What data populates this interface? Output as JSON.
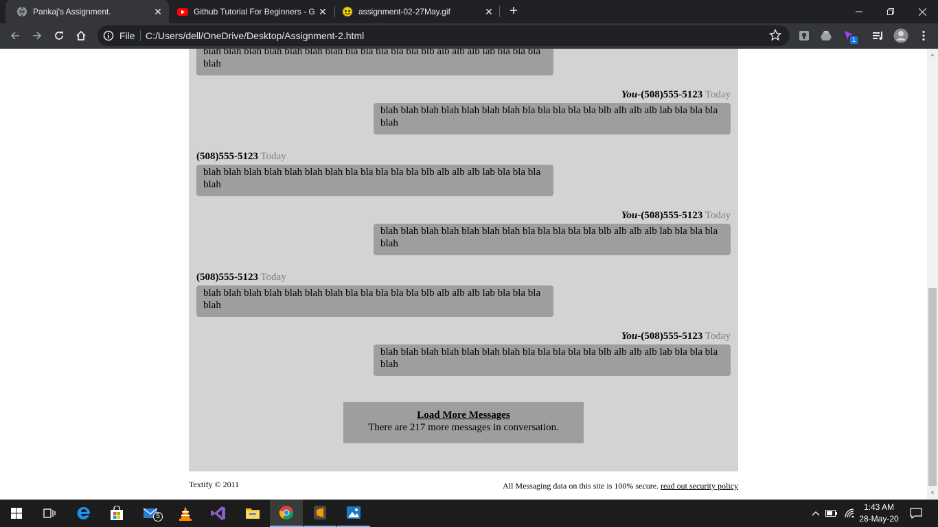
{
  "browser": {
    "tabs": [
      {
        "title": "Pankaj's Assignment.",
        "icon": "globe-icon",
        "active": true
      },
      {
        "title": "Github Tutorial For Beginners - G",
        "icon": "youtube-icon",
        "active": false
      },
      {
        "title": "assignment-02-27May.gif",
        "icon": "gif-smiley-icon",
        "active": false
      }
    ],
    "address": {
      "scheme_label": "File",
      "url": "C:/Users/dell/OneDrive/Desktop/Assignment-2.html"
    },
    "extension_badge": "1"
  },
  "messages": [
    {
      "side": "left",
      "sender": "",
      "time": "",
      "text": "blah blah blah blah blah blah blah bla bla bla bla bla blb alb alb alb lab bla bla bla blah"
    },
    {
      "side": "right",
      "you_label": "You",
      "sender": "-(508)555-5123",
      "time": "Today",
      "text": "blah blah blah blah blah blah blah bla bla bla bla bla blb alb alb alb lab bla bla bla blah"
    },
    {
      "side": "left",
      "sender": "(508)555-5123",
      "time": "Today",
      "text": "blah blah blah blah blah blah blah bla bla bla bla bla blb alb alb alb lab bla bla bla blah"
    },
    {
      "side": "right",
      "you_label": "You",
      "sender": "-(508)555-5123",
      "time": "Today",
      "text": "blah blah blah blah blah blah blah bla bla bla bla bla blb alb alb alb lab bla bla bla blah"
    },
    {
      "side": "left",
      "sender": "(508)555-5123",
      "time": "Today",
      "text": "blah blah blah blah blah blah blah bla bla bla bla bla blb alb alb alb lab bla bla bla blah"
    },
    {
      "side": "right",
      "you_label": "You",
      "sender": "-(508)555-5123",
      "time": "Today",
      "text": "blah blah blah blah blah blah blah bla bla bla bla bla blb alb alb alb lab bla bla bla blah"
    }
  ],
  "load_more": {
    "link": "Load More Messages",
    "note": "There are 217 more messages in conversation."
  },
  "footer": {
    "copyright": "Textify © 2011",
    "security_text": "All Messaging data on this site is 100% secure.",
    "security_link": "read out security policy"
  },
  "taskbar": {
    "mail_badge": "5",
    "time": "1:43 AM",
    "date": "28-May-20"
  },
  "colors": {
    "chat_bg": "#d3d3d3",
    "bubble_bg": "#9e9e9e",
    "time_text": "#808080",
    "chrome_dark": "#202124",
    "chrome_toolbar": "#35363a",
    "taskbar": "#1c1c1c"
  }
}
